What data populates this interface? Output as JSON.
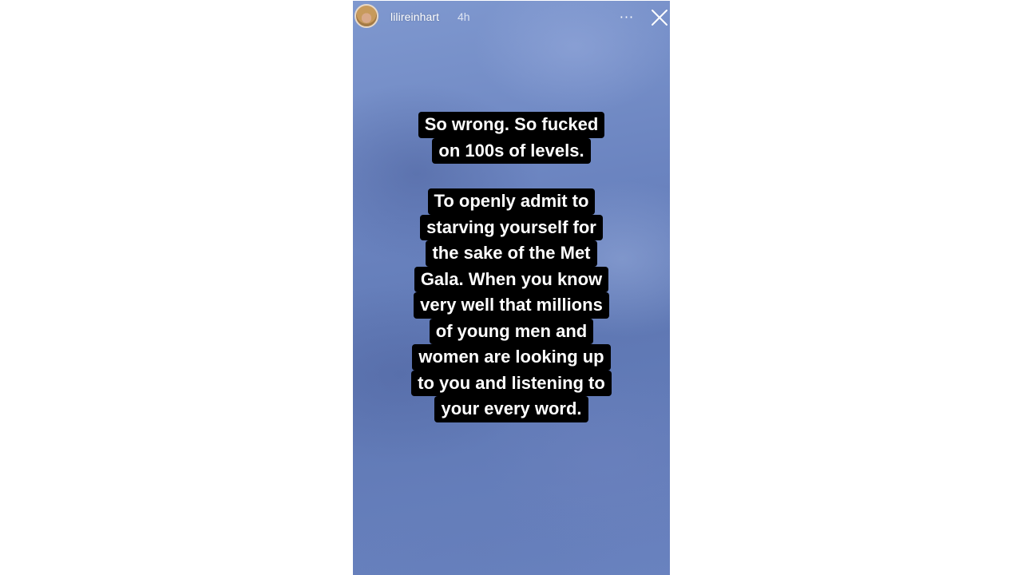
{
  "story": {
    "username": "lilireinhart",
    "time_ago": "4h",
    "more_icon": "more-horizontal-icon",
    "more_glyph": "···",
    "close_icon": "close-icon",
    "caption_blocks": [
      {
        "lines": [
          "So wrong. So fucked",
          "on 100s of levels."
        ]
      },
      {
        "lines": [
          "To openly admit to",
          "starving yourself for",
          "the sake of the Met",
          "Gala. When you know",
          "very well that millions",
          "of young men and",
          "women are looking up",
          "to you and listening to",
          "your every word."
        ]
      }
    ],
    "colors": {
      "text_background": "#000000",
      "text_color": "#ffffff",
      "background_blue": "#6b84c0"
    }
  }
}
